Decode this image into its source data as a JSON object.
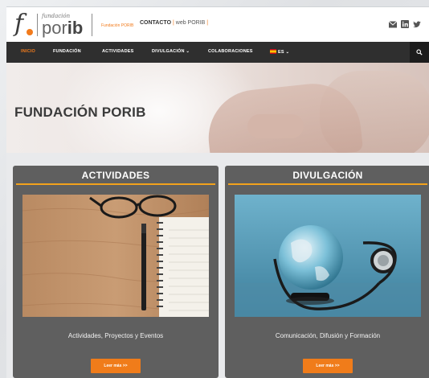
{
  "brand": {
    "logo_f": "f",
    "logo_small": "fundación",
    "logo_por": "por",
    "logo_ib": "ib",
    "subtitle": "Fundación PORIB"
  },
  "contact": {
    "label": "CONTACTO",
    "separator": "|",
    "web": "web PORIB",
    "separator_end": "|"
  },
  "social": [
    {
      "name": "email"
    },
    {
      "name": "linkedin"
    },
    {
      "name": "twitter"
    }
  ],
  "nav": {
    "items": [
      {
        "label": "INICIO",
        "active": true
      },
      {
        "label": "FUNDACIÓN"
      },
      {
        "label": "ACTIVIDADES"
      },
      {
        "label": "DIVULGACIÓN ⌄"
      },
      {
        "label": "COLABORACIONES"
      },
      {
        "label": "ES ⌄"
      }
    ]
  },
  "hero": {
    "title": "FUNDACIÓN PORIB"
  },
  "cards": [
    {
      "title": "ACTIVIDADES",
      "caption": "Actividades, Proyectos y Eventos",
      "button": "Leer más >>"
    },
    {
      "title": "DIVULGACIÓN",
      "caption": "Comunicación, Difusión y Formación",
      "button": "Leer más >>"
    }
  ],
  "colors": {
    "accent": "#f07c1a",
    "nav_bg": "#2f2f2f",
    "card_bg": "#5f5f5f",
    "divider": "#f2a21c"
  }
}
